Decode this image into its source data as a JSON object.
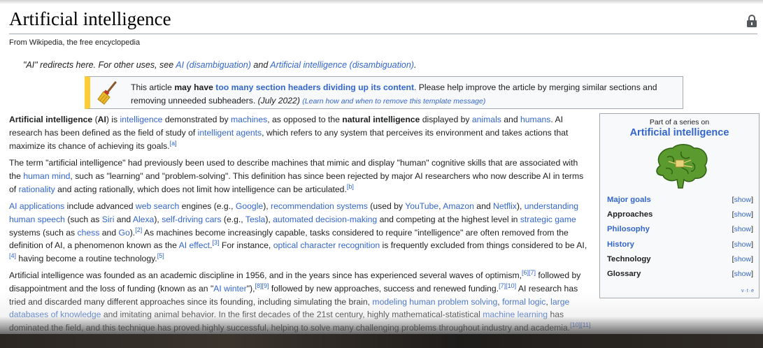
{
  "article": {
    "title": "Artificial intelligence",
    "subtitle": "From Wikipedia, the free encyclopedia"
  },
  "hatnote": {
    "pre": "\"AI\" redirects here. For other uses, see ",
    "link1": "AI (disambiguation)",
    "mid": " and ",
    "link2": "Artificial intelligence (disambiguation)",
    "post": "."
  },
  "notice": {
    "t1": "This article ",
    "bold": "may have",
    "t2": " ",
    "link": "too many section headers dividing up its content",
    "t3": ". Please help improve the article by merging similar sections and removing unneeded subheaders. ",
    "date": "(July 2022)",
    "t4": " ",
    "small": "(Learn how and when to remove this template message)"
  },
  "p1": {
    "b1": "Artificial intelligence",
    "t1": " (",
    "b2": "AI",
    "t2": ") is ",
    "l1": "intelligence",
    "t3": " demonstrated by ",
    "l2": "machines",
    "t4": ", as opposed to the ",
    "b3": "natural intelligence",
    "t5": " displayed by ",
    "l3": "animals",
    "t6": " and ",
    "l4": "humans",
    "t7": ". AI research has been defined as the field of study of ",
    "l5": "intelligent agents",
    "t8": ", which refers to any system that perceives its environment and takes actions that maximize its chance of achieving its goals.",
    "ref1": "[a]"
  },
  "p2": {
    "t1": "The term \"artificial intelligence\" had previously been used to describe machines that mimic and display \"human\" cognitive skills that are associated with the ",
    "l1": "human mind",
    "t2": ", such as \"learning\" and \"problem-solving\". This definition has since been rejected by major AI researchers who now describe AI in terms of ",
    "l2": "rationality",
    "t3": " and acting rationally, which does not limit how intelligence can be articulated.",
    "ref1": "[b]"
  },
  "p3": {
    "l1": "AI applications",
    "t1": " include advanced ",
    "l2": "web search",
    "t2": " engines (e.g., ",
    "l3": "Google",
    "t3": "), ",
    "l4": "recommendation systems",
    "t4": " (used by ",
    "l5": "YouTube",
    "t5": ", ",
    "l6": "Amazon",
    "t6": " and ",
    "l7": "Netflix",
    "t7": "), ",
    "l8": "understanding human speech",
    "t8": " (such as ",
    "l9": "Siri",
    "t9": " and ",
    "l10": "Alexa",
    "t10": "), ",
    "l11": "self-driving cars",
    "t11": " (e.g., ",
    "l12": "Tesla",
    "t12": "), ",
    "l13": "automated decision-making",
    "t13": " and competing at the highest level in ",
    "l14": "strategic game",
    "t14": " systems (such as ",
    "l15": "chess",
    "t15": " and ",
    "l16": "Go",
    "t16": ").",
    "ref1": "[2]",
    "t17": " As machines become increasingly capable, tasks considered to require \"intelligence\" are often removed from the definition of AI, a phenomenon known as the ",
    "l17": "AI effect",
    "t18": ".",
    "ref2": "[3]",
    "t19": " For instance, ",
    "l18": "optical character recognition",
    "t20": " is frequently excluded from things considered to be AI,",
    "ref3": "[4]",
    "t21": " having become a routine technology.",
    "ref4": "[5]"
  },
  "p4": {
    "t1": "Artificial intelligence was founded as an academic discipline in 1956, and in the years since has experienced several waves of optimism,",
    "ref1": "[6][7]",
    "t2": " followed by disappointment and the loss of funding (known as an \"",
    "l1": "AI winter",
    "t3": "\"),",
    "ref2": "[8][9]",
    "t4": " followed by new approaches, success and renewed funding.",
    "ref3": "[7][10]",
    "t5": " AI research has tried and discarded many different approaches since its founding, including simulating the brain, ",
    "l2": "modeling human problem solving",
    "t6": ", ",
    "l3": "formal logic",
    "t7": ", ",
    "l4": "large databases of knowledge",
    "t8": " and imitating animal behavior. In the first decades of the 21st century, highly mathematical-statistical ",
    "l5": "machine learning",
    "t9": " has dominated the field, and this technique has proved highly successful, helping to solve many challenging problems throughout industry and academia.",
    "ref4": "[10][11]"
  },
  "infobox": {
    "above": "Part of a series on",
    "title": "Artificial intelligence",
    "rows": [
      {
        "label": "Major goals",
        "show": "show"
      },
      {
        "label": "Approaches",
        "show": "show"
      },
      {
        "label": "Philosophy",
        "show": "show"
      },
      {
        "label": "History",
        "show": "show"
      },
      {
        "label": "Technology",
        "show": "show"
      },
      {
        "label": "Glossary",
        "show": "show"
      }
    ],
    "vte": "v·t·e"
  },
  "colors": {
    "link": "#3366cc",
    "text": "#202122",
    "notice_bar": "#ffcc33",
    "brain": "#5a9a2e"
  },
  "icons": {
    "lock": "lock-icon",
    "broom": "broom-icon",
    "brain": "brain-icon"
  }
}
